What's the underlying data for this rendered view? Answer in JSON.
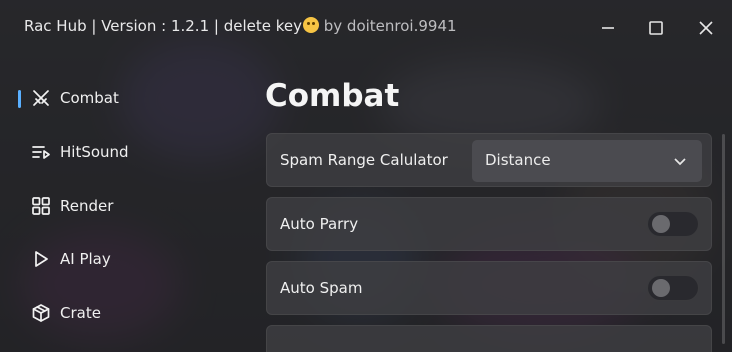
{
  "window": {
    "title_main": "Rac Hub | Version : 1.2.1 | delete key",
    "title_author": " by doitenroi.9941",
    "controls": [
      "minimize-icon",
      "maximize-icon",
      "close-icon"
    ]
  },
  "sidebar": {
    "items": [
      {
        "label": "Combat",
        "icon": "swords-icon",
        "active": true
      },
      {
        "label": "HitSound",
        "icon": "playlist-icon",
        "active": false
      },
      {
        "label": "Render",
        "icon": "grid-icon",
        "active": false
      },
      {
        "label": "AI Play",
        "icon": "play-icon",
        "active": false
      },
      {
        "label": "Crate",
        "icon": "box-icon",
        "active": false
      }
    ]
  },
  "main": {
    "title": "Combat",
    "settings": [
      {
        "label": "Spam Range Calulator",
        "type": "dropdown",
        "value": "Distance"
      },
      {
        "label": "Auto Parry",
        "type": "toggle",
        "enabled": false
      },
      {
        "label": "Auto Spam",
        "type": "toggle",
        "enabled": false
      }
    ]
  },
  "colors": {
    "accent": "#5ab0ff",
    "panel": "#3e3e42",
    "background": "#2f2f31"
  }
}
